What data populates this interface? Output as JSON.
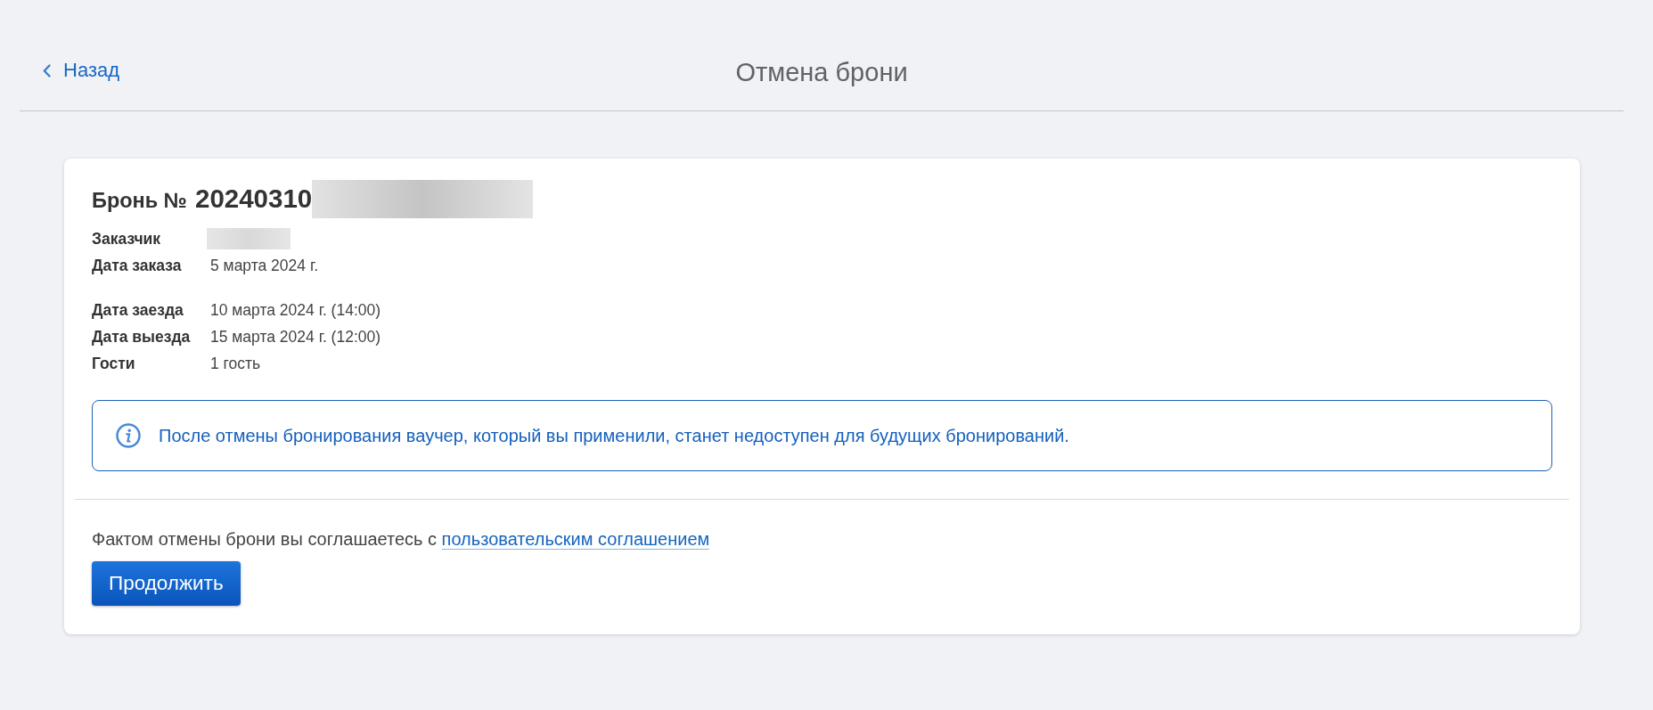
{
  "header": {
    "back_link": "Назад",
    "title": "Отмена брони"
  },
  "booking": {
    "heading_label": "Бронь №",
    "number": "20240310",
    "number_redacted": true,
    "detail_groups": [
      [
        {
          "label": "Заказчик",
          "redacted": true
        },
        {
          "label": "Дата заказа",
          "value": "5 марта 2024 г.",
          "redacted": false
        }
      ],
      [
        {
          "label": "Дата заезда",
          "value": "10 марта 2024 г. (14:00)",
          "redacted": false
        },
        {
          "label": "Дата выезда",
          "value": "15 марта 2024 г. (12:00)",
          "redacted": false
        },
        {
          "label": "Гости",
          "value": "1 гость",
          "redacted": false
        }
      ]
    ],
    "notice": {
      "text": "После отмены бронирования ваучер, который вы применили, станет недоступен для будущих бронирований."
    },
    "agreement": {
      "text": "Фактом отмены брони вы соглашаетесь с",
      "link": "пользовательским соглашением"
    },
    "continue_button": "Продолжить"
  }
}
